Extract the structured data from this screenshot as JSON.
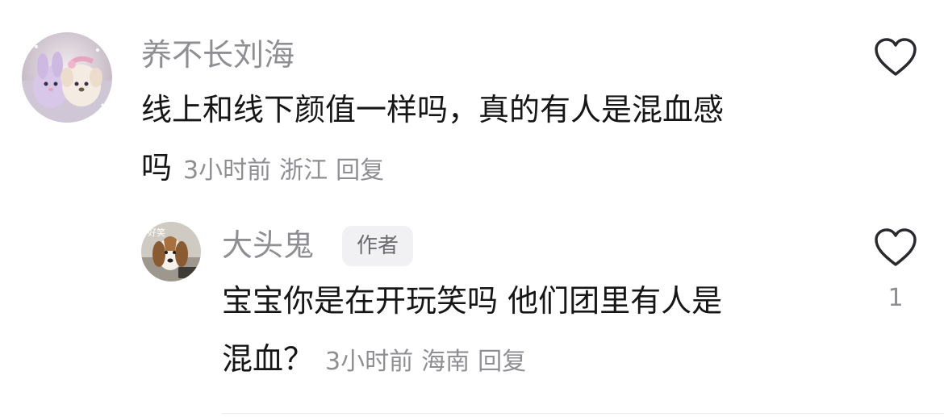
{
  "comments": [
    {
      "username": "养不长刘海",
      "text_line1": "线上和线下颜值一样吗，真的有人是混血感",
      "text_line2": "吗",
      "time": "3小时前",
      "location": "浙江",
      "reply_label": "回复",
      "avatar_icon": "plush-toys-avatar",
      "like_icon": "heart-outline-icon",
      "like_count": ""
    },
    {
      "username": "大头鬼",
      "badge": "作者",
      "text_line1": "宝宝你是在开玩笑吗 他们团里有人是",
      "text_line2": "混血？",
      "time": "3小时前",
      "location": "海南",
      "reply_label": "回复",
      "avatar_icon": "puppy-avatar",
      "avatar_caption": "好笑",
      "like_icon": "heart-outline-icon",
      "like_count": "1"
    }
  ]
}
